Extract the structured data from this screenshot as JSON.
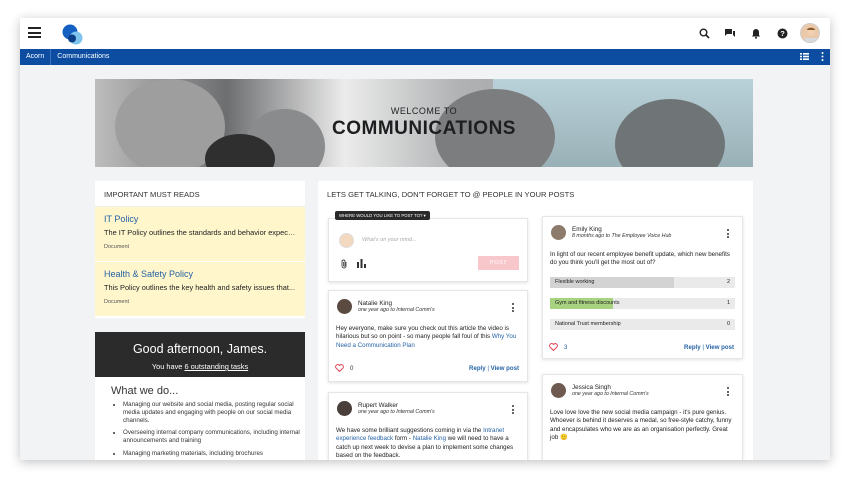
{
  "nav": {
    "crumb1": "Acorn",
    "crumb2": "Communications"
  },
  "hero": {
    "welcome": "WELCOME TO",
    "title": "COMMUNICATIONS"
  },
  "must_reads": {
    "header": "IMPORTANT MUST READS",
    "items": [
      {
        "title": "IT Policy",
        "desc": "The IT Policy outlines the standards and behavior expect...",
        "type": "Document"
      },
      {
        "title": "Health & Safety Policy",
        "desc": "This Policy outlines the key health and safety issues that...",
        "type": "Document"
      }
    ]
  },
  "greeting": {
    "title": "Good afternoon, James.",
    "pre": "You have ",
    "link": "6 outstanding tasks"
  },
  "what_we_do": {
    "title": "What we do...",
    "items": [
      "Managing our website and social media, posting regular social media updates and engaging with people on our social media channels.",
      "Overseeing internal company communications, including internal announcements and training",
      "Managing marketing materials, including brochures"
    ]
  },
  "feed": {
    "header": "LETS GET TALKING, DON'T FORGET TO @ PEOPLE IN YOUR POSTS"
  },
  "composer": {
    "where": "WHERE WOULD YOU LIKE TO POST TO? ▾",
    "placeholder": "What's on your mind...",
    "post": "POST"
  },
  "posts": {
    "natalie": {
      "name": "Natalie King",
      "time": "one year ago to ",
      "group": "Internal Comm's",
      "body": "Hey everyone, make sure you check out this article the video is hilarious but so on point - so many people fall foul of this ",
      "link": "Why You Need a Communication Plan",
      "likes": "0",
      "reply": "Reply",
      "view": "View post"
    },
    "rupert": {
      "name": "Rupert Walker",
      "time": "one year ago to ",
      "group": "Internal Comm's",
      "b1": "We have some brilliant suggestions coming in via the ",
      "l1": "Intranet experience feedback",
      "b2": " form - ",
      "l2": "Natalie King",
      "b3": " we will need to have a catch up next week to devise a plan to implement some changes based on the feedback."
    },
    "emily": {
      "name": "Emily King",
      "time": "8 months ago to ",
      "group": "The Employee Voice Hub",
      "body": "In light of our recent employee benefit update, which new benefits do you think you'll get the most out of?",
      "options": [
        {
          "label": "Flexible working",
          "count": "2",
          "fraction": 0.67,
          "color": "#d3d3d3"
        },
        {
          "label": "Gym and fitness discounts",
          "count": "1",
          "fraction": 0.34,
          "color": "#a7d27f"
        },
        {
          "label": "National Trust membership",
          "count": "0",
          "fraction": 0,
          "color": "#d3d3d3"
        }
      ],
      "likes": "3",
      "reply": "Reply",
      "view": "View post"
    },
    "jessica": {
      "name": "Jessica Singh",
      "time": "one year ago to ",
      "group": "Internal Comm's",
      "body": "Love love love the new social media campaign - it's pure genius. Whoever is behind it deserves a medal, so free-style catchy, funny and encapsulates who we are as an organisation perfectly. Great job 🙂"
    }
  },
  "colors": {
    "brand": "#0c4da2",
    "accent_like": "#e0334a",
    "link": "#2663a5"
  }
}
